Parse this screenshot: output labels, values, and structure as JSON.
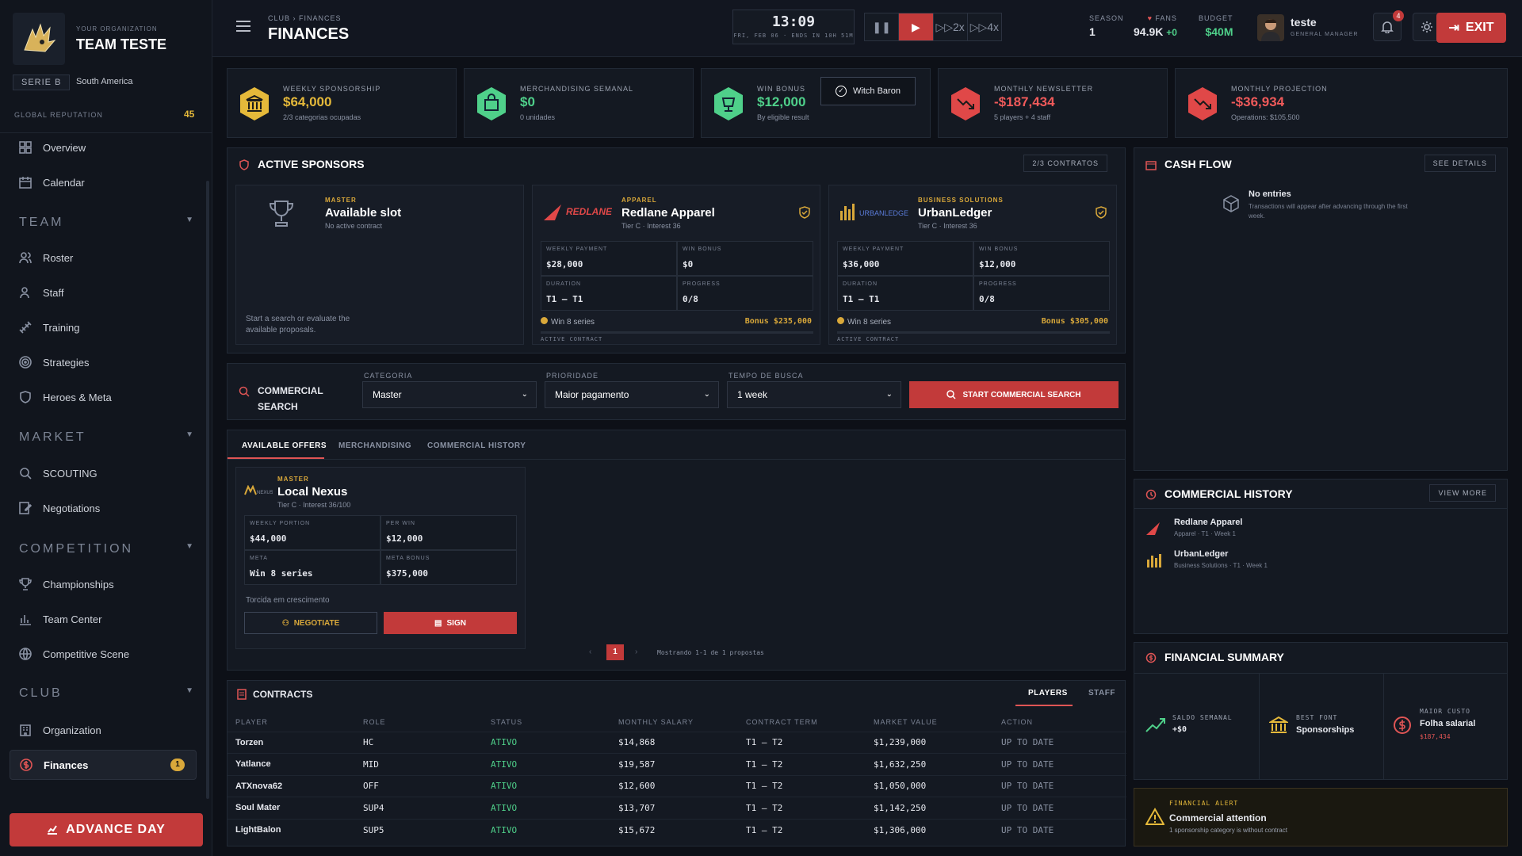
{
  "org": {
    "small": "YOUR ORGANIZATION",
    "name": "TEAM TESTE",
    "serie": "SERIE B",
    "region": "South America",
    "rep_label": "GLOBAL REPUTATION",
    "rep_value": "45"
  },
  "nav": {
    "overview": "Overview",
    "calendar": "Calendar",
    "team": "TEAM",
    "roster": "Roster",
    "staff": "Staff",
    "training": "Training",
    "strategies": "Strategies",
    "heroes": "Heroes & Meta",
    "market": "MARKET",
    "scouting": "SCOUTING",
    "negotiations": "Negotiations",
    "competition": "COMPETITION",
    "championships": "Championships",
    "team_center": "Team Center",
    "competitive": "Competitive Scene",
    "club": "CLUB",
    "organization": "Organization",
    "finances": "Finances",
    "finances_badge": "1",
    "advance": "ADVANCE DAY"
  },
  "header": {
    "crumb": "CLUB  ›  FINANCES",
    "title": "FINANCES",
    "time": "13:09",
    "date": "FRI, FEB 06 · ENDS IN 10H 51M",
    "speed2": "2x",
    "speed4": "4x",
    "season_l": "SEASON",
    "season_v": "1",
    "fans_l": "FANS",
    "fans_v": "94.9K",
    "fans_delta": "+0",
    "budget_l": "BUDGET",
    "budget_v": "$40M",
    "user": "teste",
    "role": "GENERAL MANAGER",
    "notif": "4",
    "exit": "EXIT"
  },
  "kpis": [
    {
      "label": "WEEKLY SPONSORSHIP",
      "value": "$64,000",
      "sub": "2/3 categorias ocupadas",
      "color": "#e5b93a"
    },
    {
      "label": "MERCHANDISING SEMANAL",
      "value": "$0",
      "sub": "0 unidades",
      "color": "#4fd08a"
    },
    {
      "label": "WIN BONUS",
      "value": "$12,000",
      "sub": "By eligible result",
      "color": "#4fd08a",
      "btn": "Witch Baron"
    },
    {
      "label": "MONTHLY NEWSLETTER",
      "value": "-$187,434",
      "sub": "5 players + 4 staff",
      "color": "#f05a5a"
    },
    {
      "label": "MONTHLY PROJECTION",
      "value": "-$36,934",
      "sub": "Operations: $105,500",
      "color": "#f05a5a"
    }
  ],
  "sponsors": {
    "title": "ACTIVE SPONSORS",
    "count": "2/3 CONTRATOS",
    "slot": {
      "tier": "MASTER",
      "name": "Available slot",
      "sub": "No active contract",
      "hint": "Start a search or evaluate the available proposals."
    },
    "cards": [
      {
        "tier": "APPAREL",
        "name": "Redlane Apparel",
        "sub": "Tier C · Interest 36",
        "l1": "WEEKLY PAYMENT",
        "v1": "$28,000",
        "l2": "WIN BONUS",
        "v2": "$0",
        "l3": "DURATION",
        "v3": "T1 — T1",
        "l4": "PROGRESS",
        "v4": "0/8",
        "goal": "Win 8 series",
        "bonus": "Bonus $235,000",
        "status": "ACTIVE CONTRACT"
      },
      {
        "tier": "BUSINESS SOLUTIONS",
        "name": "UrbanLedger",
        "sub": "Tier C · Interest 36",
        "l1": "WEEKLY PAYMENT",
        "v1": "$36,000",
        "l2": "WIN BONUS",
        "v2": "$12,000",
        "l3": "DURATION",
        "v3": "T1 — T1",
        "l4": "PROGRESS",
        "v4": "0/8",
        "goal": "Win 8 series",
        "bonus": "Bonus $305,000",
        "status": "ACTIVE CONTRACT"
      }
    ]
  },
  "search": {
    "title1": "COMMERCIAL",
    "title2": "SEARCH",
    "cat_l": "CATEGORIA",
    "cat_v": "Master",
    "pri_l": "PRIORIDADE",
    "pri_v": "Maior pagamento",
    "time_l": "TEMPO DE BUSCA",
    "time_v": "1 week",
    "btn": "START COMMERCIAL SEARCH"
  },
  "offers": {
    "tabs": [
      "AVAILABLE OFFERS",
      "MERCHANDISING",
      "COMMERCIAL HISTORY"
    ],
    "offer": {
      "tier": "MASTER",
      "name": "Local Nexus",
      "sub": "Tier C · Interest 36/100",
      "l1": "WEEKLY PORTION",
      "v1": "$44,000",
      "l2": "PER WIN",
      "v2": "$12,000",
      "l3": "META",
      "v3": "Win 8 series",
      "l4": "META BONUS",
      "v4": "$375,000",
      "note": "Torcida em crescimento",
      "neg": "NEGOTIATE",
      "sign": "SIGN"
    },
    "page": "1",
    "showing": "Mostrando 1-1 de 1 propostas"
  },
  "contracts": {
    "title": "CONTRACTS",
    "tab_players": "PLAYERS",
    "tab_staff": "STAFF",
    "cols": [
      "PLAYER",
      "ROLE",
      "STATUS",
      "MONTHLY SALARY",
      "CONTRACT TERM",
      "MARKET VALUE",
      "ACTION"
    ],
    "rows": [
      [
        "Torzen",
        "HC",
        "ATIVO",
        "$14,868",
        "T1 — T2",
        "$1,239,000",
        "UP TO DATE"
      ],
      [
        "Yatlance",
        "MID",
        "ATIVO",
        "$19,587",
        "T1 — T2",
        "$1,632,250",
        "UP TO DATE"
      ],
      [
        "ATXnova62",
        "OFF",
        "ATIVO",
        "$12,600",
        "T1 — T2",
        "$1,050,000",
        "UP TO DATE"
      ],
      [
        "Soul Mater",
        "SUP4",
        "ATIVO",
        "$13,707",
        "T1 — T2",
        "$1,142,250",
        "UP TO DATE"
      ],
      [
        "LightBalon",
        "SUP5",
        "ATIVO",
        "$15,672",
        "T1 — T2",
        "$1,306,000",
        "UP TO DATE"
      ]
    ]
  },
  "cashflow": {
    "title": "CASH FLOW",
    "btn": "SEE DETAILS",
    "empty": "No entries",
    "empty_sub": "Transactions will appear after advancing through the first week."
  },
  "history": {
    "title": "COMMERCIAL HISTORY",
    "btn": "VIEW MORE",
    "items": [
      {
        "name": "Redlane Apparel",
        "sub": "Apparel · T1 · Week 1"
      },
      {
        "name": "UrbanLedger",
        "sub": "Business Solutions · T1 · Week 1"
      }
    ]
  },
  "summary": {
    "title": "FINANCIAL SUMMARY",
    "l1": "SALDO SEMANAL",
    "v1": "+$0",
    "l2": "BEST FONT",
    "v2": "Sponsorships",
    "l3": "MAIOR CUSTO",
    "v3": "Folha salarial",
    "v3b": "$187,434"
  },
  "alert": {
    "label": "FINANCIAL ALERT",
    "title": "Commercial attention",
    "sub": "1 sponsorship category is without contract"
  }
}
